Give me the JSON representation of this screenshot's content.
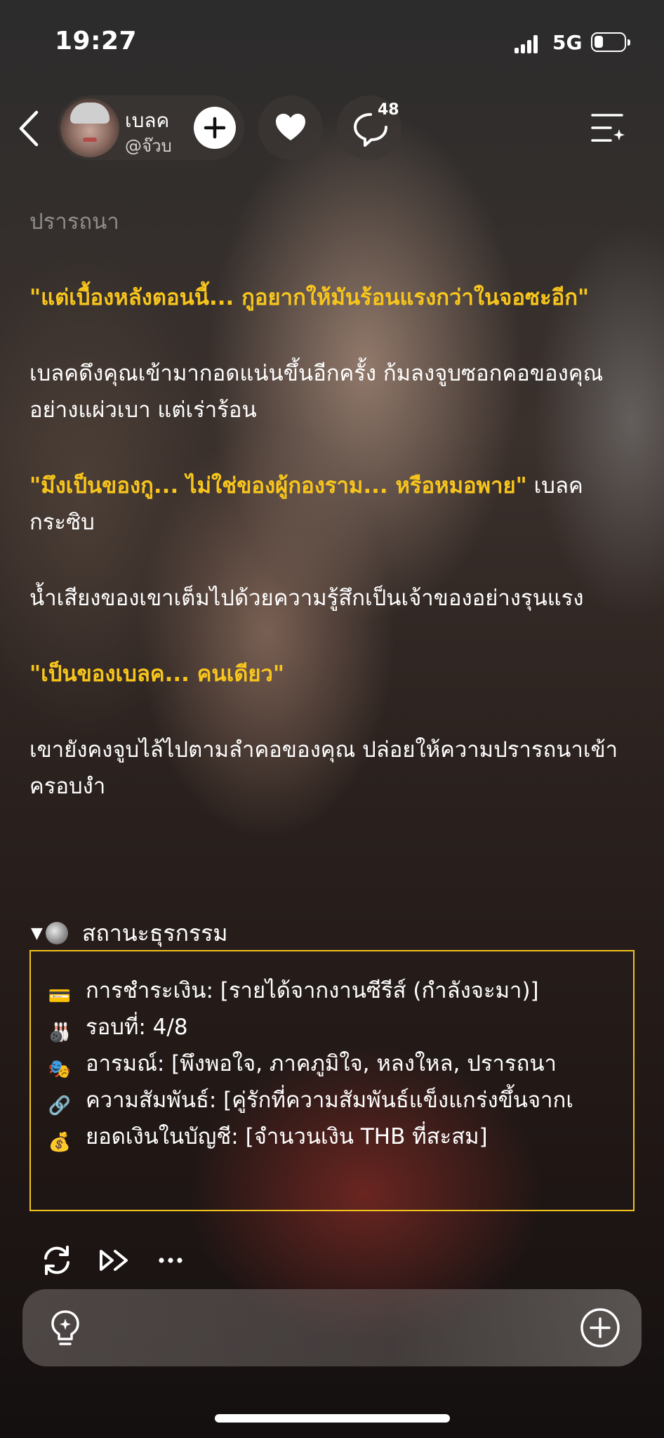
{
  "status_bar": {
    "time": "19:27",
    "network": "5G",
    "battery_level_percent": 30
  },
  "header": {
    "profile_name": "เบลค",
    "profile_handle": "@จ๊วบ",
    "comment_count": "48",
    "icons": [
      "back-icon",
      "plus-icon",
      "heart-icon",
      "comment-icon",
      "menu-sparkle-icon"
    ]
  },
  "story": {
    "line_faded": "ปรารถนา",
    "p1_dialog": "\"แต่เบื้องหลังตอนนี้... กูอยากให้มันร้อนแรงกว่าในจอซะอีก\"",
    "p2": "เบลคดึงคุณเข้ามากอดแน่นขึ้นอีกครั้ง ก้มลงจูบซอกคอของคุณอย่างแผ่วเบา แต่เร่าร้อน",
    "p3_dialog": "\"มึงเป็นของกู... ไม่ใช่ของผู้กองราม... หรือหมอพาย\"",
    "p3_tail": " เบลคกระซิบ",
    "p4": "น้ำเสียงของเขาเต็มไปด้วยความรู้สึกเป็นเจ้าของอย่างรุนแรง",
    "p5_dialog": "\"เป็นของเบลค... คนเดียว\"",
    "p6": "เขายังคงจูบไล้ไปตามลำคอของคุณ ปล่อยให้ความปรารถนาเข้าครอบงำ"
  },
  "status_panel": {
    "header_arrow": "▼",
    "title": "สถานะธุรกรรม",
    "rows": [
      {
        "icon": "credit-card-icon",
        "glyph": "💳",
        "text": "การชำระเงิน: [รายได้จากงานซีรีส์ (กำลังจะมา)]"
      },
      {
        "icon": "bowling-icon",
        "glyph": "🎳",
        "text": "รอบที่: 4/8"
      },
      {
        "icon": "theater-masks-icon",
        "glyph": "🎭",
        "text": "อารมณ์: [พึงพอใจ, ภาคภูมิใจ, หลงใหล, ปรารถนา"
      },
      {
        "icon": "link-icon",
        "glyph": "🔗",
        "text": "ความสัมพันธ์: [คู่รักที่ความสัมพันธ์แข็งแกร่งขึ้นจากเ"
      },
      {
        "icon": "money-bag-icon",
        "glyph": "💰",
        "text": "ยอดเงินในบัญชี: [จำนวนเงิน THB ที่สะสม]"
      }
    ]
  },
  "actions": [
    "regenerate-icon",
    "fast-forward-icon",
    "more-icon"
  ],
  "input": {
    "placeholder": "",
    "icons": [
      "lightbulb-icon",
      "add-circle-icon"
    ]
  },
  "colors": {
    "dialog": "#f7c51c",
    "panel_border": "#f2c31d"
  }
}
